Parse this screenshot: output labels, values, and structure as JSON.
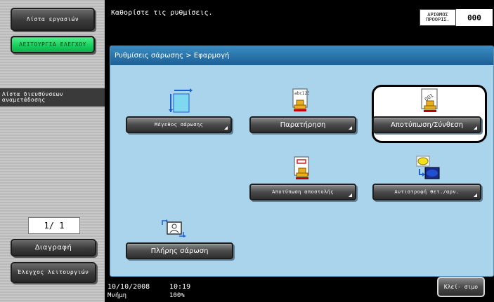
{
  "sidebar": {
    "jobs_label": "Λίστα εργασιών",
    "utility_label": "ΛΕΙΤΟΥΡΓΙΑ ΕΛΕΓΧΟΥ",
    "address_list_label": "Λίστα διευθύνσεων αναμετάδοσης",
    "page_counter": "1/ 1",
    "delete_label": "Διαγραφή",
    "check_label": "Έλεγχος λειτουργιών"
  },
  "header": {
    "message": "Καθορίστε τις ρυθμίσεις.",
    "originals_label": "ΑΡΙΘΜΟΣ ΠΡΟΟΡΙΣ.",
    "originals_count": "000"
  },
  "panel": {
    "breadcrumb": "Ρυθμίσεις σάρωσης > Εφαρμογή",
    "buttons": [
      {
        "label": "Μέγεθος σάρωσης",
        "icon": "scan-size-icon"
      },
      {
        "label": "Παρατήρηση",
        "icon": "annotation-icon"
      },
      {
        "label": "Αποτύπωση/Σύνθεση",
        "icon": "stamp-composition-icon",
        "selected": true
      },
      {
        "label": "Αποτύπωση αποστολής",
        "icon": "send-stamp-icon"
      },
      {
        "label": "Αντιστροφή θετ./αρν.",
        "icon": "invert-icon"
      },
      {
        "label": "Πλήρης σάρωση",
        "icon": "full-scan-icon"
      }
    ]
  },
  "status": {
    "date": "10/10/2008",
    "time": "10:19",
    "memory_label": "Μνήμη",
    "memory_value": "100%",
    "close_label": "Κλεί- σιμο"
  },
  "colors": {
    "accent_green": "#14cf5c",
    "panel_blue": "#a9d4ec",
    "title_blue": "#1b5f95"
  }
}
